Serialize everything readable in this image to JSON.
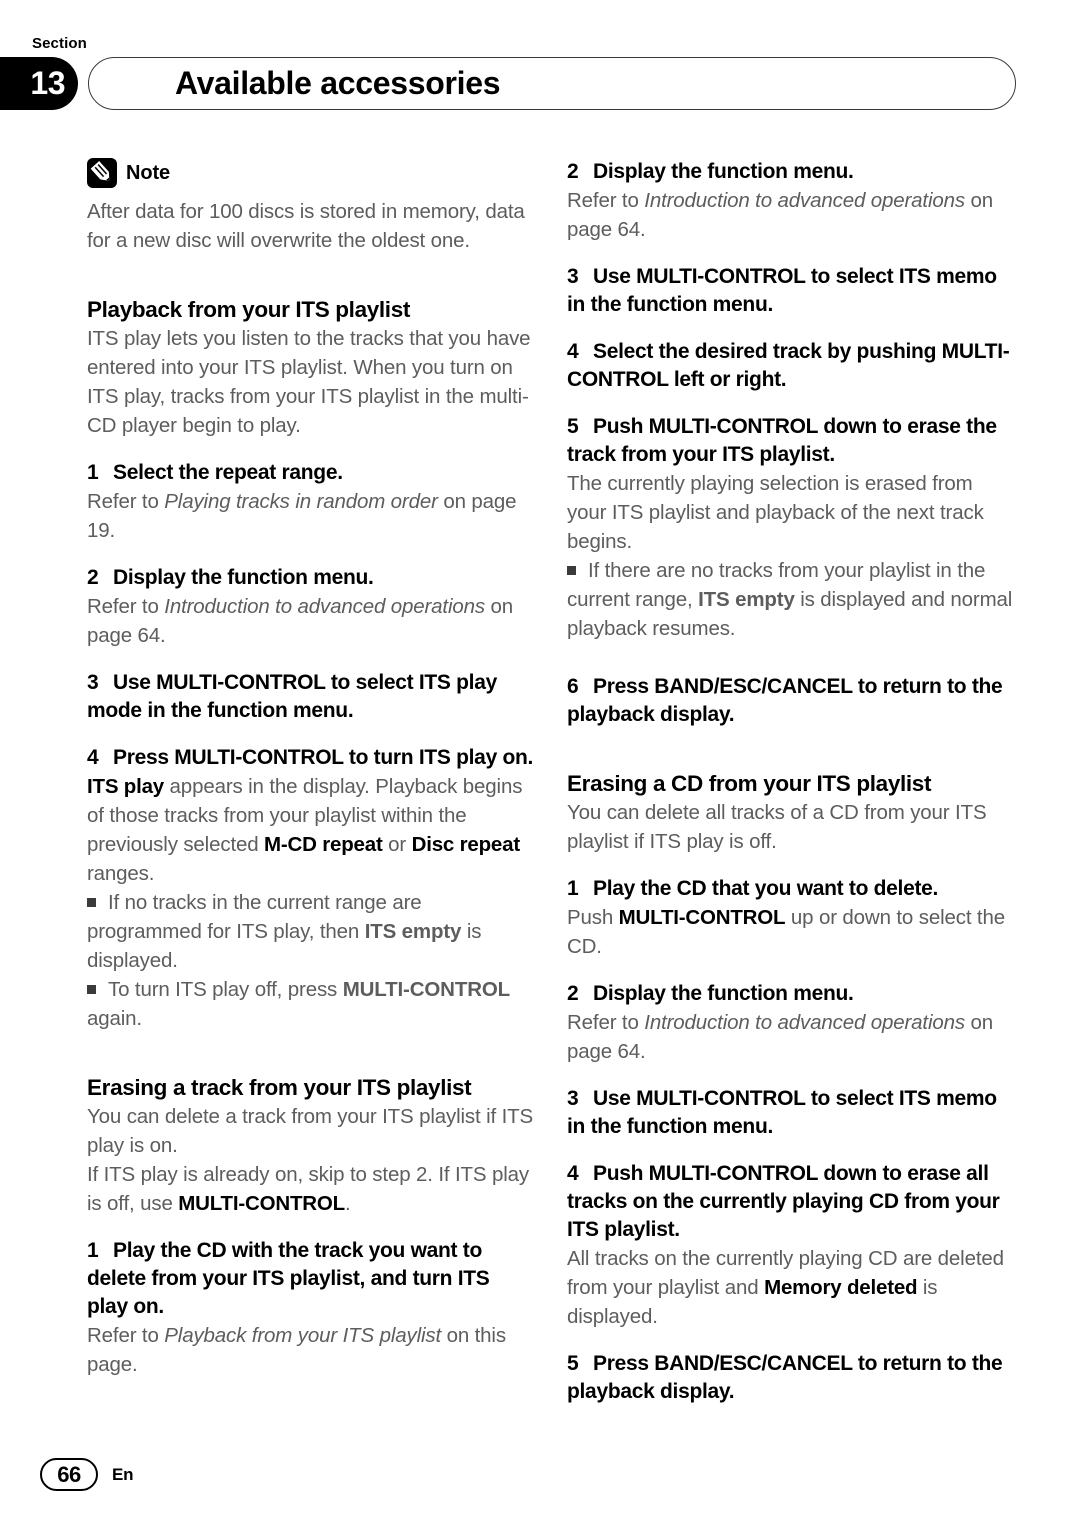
{
  "header": {
    "section_label": "Section",
    "section_number": "13",
    "title": "Available accessories"
  },
  "note": {
    "icon": "pencil-icon",
    "label": "Note",
    "body_html": "After data for 100 discs is stored in memory, data for a new disc will overwrite the oldest one."
  },
  "left_column": {
    "heading_1": "Playback from your ITS playlist",
    "intro_1": "ITS play lets you listen to the tracks that you have entered into your ITS playlist. When you turn on ITS play, tracks from your ITS playlist in the multi-CD player begin to play.",
    "steps_1": [
      {
        "num": "1",
        "title": "Select the repeat range.",
        "body_html": "Refer to <i>Playing tracks in random order</i> on page 19."
      },
      {
        "num": "2",
        "title": "Display the function menu.",
        "body_html": "Refer to <i>Introduction to advanced operations</i> on page 64."
      },
      {
        "num": "3",
        "title": "Use MULTI-CONTROL to select ITS play mode in the function menu.",
        "body_html": ""
      },
      {
        "num": "4",
        "title": "Press MULTI-CONTROL to turn ITS play on.",
        "body_html": "<b>ITS play</b> appears in the display. Playback begins of those tracks from your playlist within the previously selected <b>M-CD repeat</b> or <b>Disc repeat</b> ranges."
      }
    ],
    "bullets_1": [
      "If no tracks in the current range are programmed for ITS play, then <b>ITS empty</b> is displayed.",
      "To turn ITS play off, press <b>MULTI-CONTROL</b> again."
    ],
    "heading_2": "Erasing a track from your ITS playlist",
    "intro_2a": "You can delete a track from your ITS playlist if ITS play is on.",
    "intro_2b": "If ITS play is already on, skip to step 2. If ITS play is off, use <b>MULTI-CONTROL</b>.",
    "steps_2": [
      {
        "num": "1",
        "title": "Play the CD with the track you want to delete from your ITS playlist, and turn ITS play on.",
        "body_html": "Refer to <i>Playback from your ITS playlist</i> on this page."
      }
    ]
  },
  "right_column": {
    "steps_cont": [
      {
        "num": "2",
        "title": "Display the function menu.",
        "body_html": "Refer to <i>Introduction to advanced operations</i> on page 64."
      },
      {
        "num": "3",
        "title": "Use MULTI-CONTROL to select ITS memo in the function menu.",
        "body_html": ""
      },
      {
        "num": "4",
        "title": "Select the desired track by pushing MULTI-CONTROL left or right.",
        "body_html": ""
      },
      {
        "num": "5",
        "title": "Push MULTI-CONTROL down to erase the track from your ITS playlist.",
        "body_html": "The currently playing selection is erased from your ITS playlist and playback of the next track begins."
      }
    ],
    "bullets_cont": [
      "If there are no tracks from your playlist in the current range, <b>ITS empty</b> is displayed and normal playback resumes."
    ],
    "step_6": {
      "num": "6",
      "title": "Press BAND/ESC/CANCEL to return to the playback display."
    },
    "heading_3": "Erasing a CD from your ITS playlist",
    "intro_3": "You can delete all tracks of a CD from your ITS playlist if ITS play is off.",
    "steps_3": [
      {
        "num": "1",
        "title": "Play the CD that you want to delete.",
        "body_html": "Push <b>MULTI-CONTROL</b> up or down to select the CD."
      },
      {
        "num": "2",
        "title": "Display the function menu.",
        "body_html": "Refer to <i>Introduction to advanced operations</i> on page 64."
      },
      {
        "num": "3",
        "title": "Use MULTI-CONTROL to select ITS memo in the function menu.",
        "body_html": ""
      },
      {
        "num": "4",
        "title": "Push MULTI-CONTROL down to erase all tracks on the currently playing CD from your ITS playlist.",
        "body_html": "All tracks on the currently playing CD are deleted from your playlist and <b>Memory deleted</b> is displayed."
      },
      {
        "num": "5",
        "title": "Press BAND/ESC/CANCEL to return to the playback display.",
        "body_html": ""
      }
    ]
  },
  "footer": {
    "page_number": "66",
    "language": "En"
  }
}
